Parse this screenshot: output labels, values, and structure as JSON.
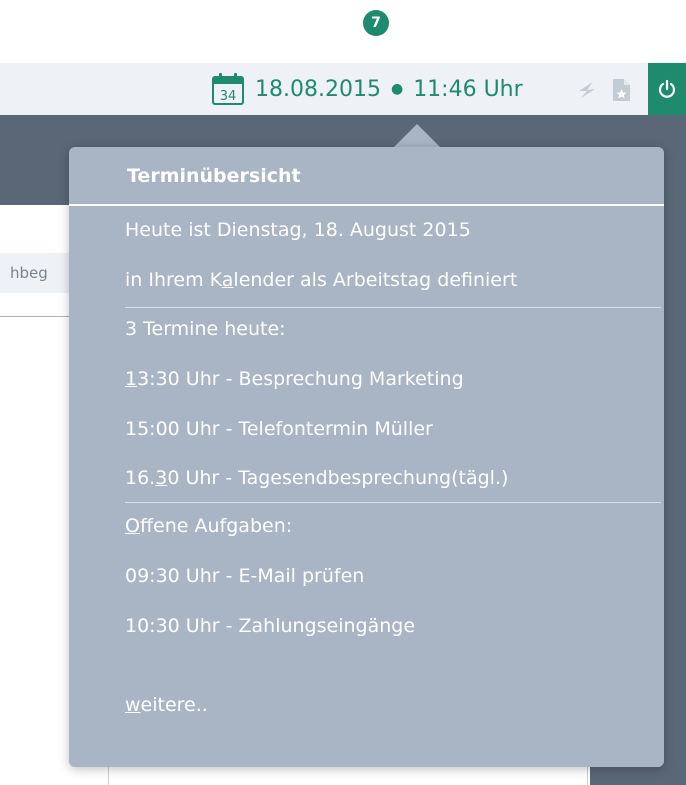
{
  "step_badge": "7",
  "topbar": {
    "calendar_day": "34",
    "date": "18.08.2015",
    "separator": "●",
    "time": "11:46 Uhr"
  },
  "background": {
    "search_text": "hbeg"
  },
  "popover": {
    "title": "Terminübersicht",
    "today_line": "Heute ist Dienstag, 18. August 2015",
    "calendar_line_pre": "in Ihrem K",
    "calendar_line_key": "a",
    "calendar_line_post": "lender als Arbeitstag definiert",
    "appointments_header": "3 Termine heute:",
    "appointments": [
      {
        "key": "1",
        "rest": "3:30 Uhr - Besprechung Marketing"
      },
      {
        "text": "15:00 Uhr - Telefontermin Müller"
      },
      {
        "pre": "16.",
        "key": "3",
        "rest": "0 Uhr - Tagesendbesprechung(tägl.)"
      }
    ],
    "tasks_header_key": "O",
    "tasks_header_rest": "ffene Aufgaben:",
    "tasks": [
      "09:30 Uhr - E-Mail prüfen",
      "10:30 Uhr - Zahlungseingänge"
    ],
    "more_key": "w",
    "more_rest": "eitere.."
  },
  "colors": {
    "accent": "#1e8a6e",
    "popover_bg": "#a9b4c4",
    "dark_bg": "#5a6776",
    "topbar_bg": "#eef1f5"
  },
  "icons": [
    "calendar-icon",
    "pin-icon",
    "bookmark-doc-icon",
    "power-icon"
  ]
}
